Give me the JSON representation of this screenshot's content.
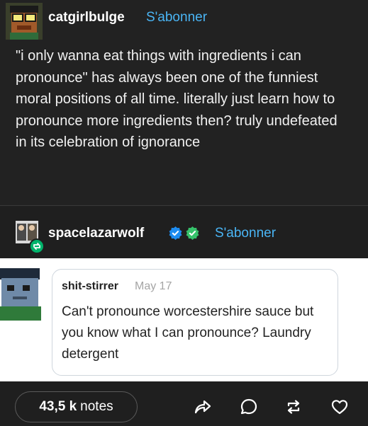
{
  "post": {
    "username": "catgirlbulge",
    "follow_label": "S'abonner",
    "text": "\"i only wanna eat things with ingredients i can pronounce\" has always been one of the funniest moral positions of all time. literally just learn how to pronounce more ingredients then? truly undefeated in its celebration of ignorance"
  },
  "reblog": {
    "username": "spacelazarwolf",
    "follow_label": "S'abonner",
    "tweet": {
      "username": "shit-stirrer",
      "date": "May 17",
      "text": "Can't pronounce worcestershire sauce but you know what I can pronounce? Laundry detergent"
    }
  },
  "footer": {
    "notes_count": "43,5 k",
    "notes_label": "notes",
    "icons": [
      "share-icon",
      "reply-icon",
      "reblog-icon",
      "like-icon"
    ]
  },
  "colors": {
    "background": "#1f1f1f",
    "accent": "#4ab5f5",
    "verified": "#1d8cf0",
    "badge_green": "#00b36b"
  }
}
